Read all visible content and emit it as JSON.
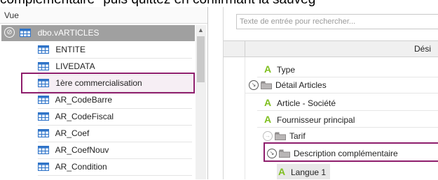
{
  "caption": "complémentaire\" puis quittez en confirmant la sauveg",
  "left_panel": {
    "header": "Vue",
    "root": {
      "label": "dbo.vARTICLES",
      "expand": "⊘"
    },
    "items": [
      {
        "label": "ENTITE"
      },
      {
        "label": "LIVEDATA"
      },
      {
        "label": "1ère commercialisation"
      },
      {
        "label": "AR_CodeBarre"
      },
      {
        "label": "AR_CodeFiscal"
      },
      {
        "label": "AR_Coef"
      },
      {
        "label": "AR_CoefNouv"
      },
      {
        "label": "AR_Condition"
      }
    ]
  },
  "right_panel": {
    "search": {
      "placeholder": "Texte de entrée pour rechercher..."
    },
    "column_header": "Dési",
    "rows": [
      {
        "icon": "A",
        "label": "Type"
      },
      {
        "label": "Détail Articles"
      },
      {
        "icon": "A",
        "label": "Article - Société"
      },
      {
        "icon": "A",
        "label": "Fournisseur principal"
      },
      {
        "label": "Tarif"
      },
      {
        "label": "Description complémentaire"
      },
      {
        "icon": "A",
        "label": "Langue 1"
      }
    ]
  },
  "colors": {
    "accent_highlight": "#8e1d6c",
    "attribute_icon": "#7fbf1f",
    "root_row": "#a0a0a0"
  }
}
